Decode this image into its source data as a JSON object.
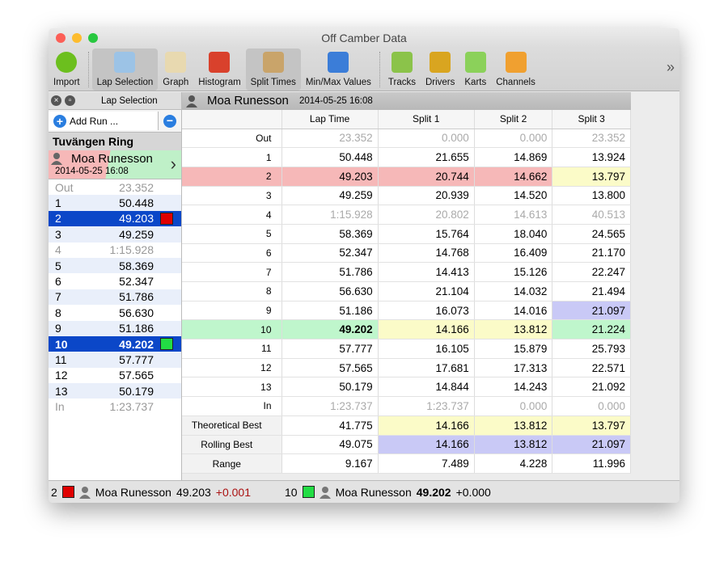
{
  "window": {
    "title": "Off Camber Data"
  },
  "toolbar": {
    "items": [
      {
        "label": "Import",
        "icon": "import-icon",
        "color": "#6cbf1e"
      },
      {
        "label": "Lap Selection",
        "icon": "lap-selection-icon",
        "color": "#9cc3e6",
        "selected": true
      },
      {
        "label": "Graph",
        "icon": "graph-icon",
        "color": "#e8d9b0"
      },
      {
        "label": "Histogram",
        "icon": "histogram-icon",
        "color": "#d9412c"
      },
      {
        "label": "Split Times",
        "icon": "split-times-icon",
        "color": "#c9a46a",
        "selected": true
      },
      {
        "label": "Min/Max Values",
        "icon": "min-max-icon",
        "color": "#3b7dd8"
      },
      {
        "label": "Tracks",
        "icon": "tracks-icon",
        "color": "#8bc34a"
      },
      {
        "label": "Drivers",
        "icon": "drivers-icon",
        "color": "#d9a520"
      },
      {
        "label": "Karts",
        "icon": "karts-icon",
        "color": "#8bd15a"
      },
      {
        "label": "Channels",
        "icon": "channels-icon",
        "color": "#f0a030"
      }
    ],
    "more": "»"
  },
  "left": {
    "title": "Lap Selection",
    "add_run": "Add Run ...",
    "track": "Tuvängen Ring",
    "run": {
      "driver": "Moa Runesson",
      "date": "2014-05-25 16:08"
    },
    "laps": [
      {
        "n": "Out",
        "t": "23.352",
        "dim": true
      },
      {
        "n": "1",
        "t": "50.448"
      },
      {
        "n": "2",
        "t": "49.203",
        "sel": true,
        "swatch": "#e00000"
      },
      {
        "n": "3",
        "t": "49.259"
      },
      {
        "n": "4",
        "t": "1:15.928",
        "dim": true
      },
      {
        "n": "5",
        "t": "58.369"
      },
      {
        "n": "6",
        "t": "52.347"
      },
      {
        "n": "7",
        "t": "51.786"
      },
      {
        "n": "8",
        "t": "56.630"
      },
      {
        "n": "9",
        "t": "51.186"
      },
      {
        "n": "10",
        "t": "49.202",
        "sel": true,
        "bold": true,
        "swatch": "#22dd44"
      },
      {
        "n": "11",
        "t": "57.777"
      },
      {
        "n": "12",
        "t": "57.565"
      },
      {
        "n": "13",
        "t": "50.179"
      },
      {
        "n": "In",
        "t": "1:23.737",
        "dim": true
      }
    ]
  },
  "main": {
    "driver": "Moa Runesson",
    "date": "2014-05-25 16:08",
    "columns": [
      "",
      "Lap Time",
      "Split 1",
      "Split 2",
      "Split 3"
    ],
    "rows": [
      {
        "cells": [
          "Out",
          "23.352",
          "0.000",
          "0.000",
          "23.352"
        ],
        "hl": [
          "",
          "dim",
          "dim",
          "dim",
          "dim"
        ]
      },
      {
        "cells": [
          "1",
          "50.448",
          "21.655",
          "14.869",
          "13.924"
        ],
        "hl": [
          "",
          "",
          "",
          "",
          ""
        ]
      },
      {
        "cells": [
          "2",
          "49.203",
          "20.744",
          "14.662",
          "13.797"
        ],
        "hl": [
          "red",
          "red",
          "red",
          "red",
          "yellow"
        ]
      },
      {
        "cells": [
          "3",
          "49.259",
          "20.939",
          "14.520",
          "13.800"
        ],
        "hl": [
          "",
          "",
          "",
          "",
          ""
        ]
      },
      {
        "cells": [
          "4",
          "1:15.928",
          "20.802",
          "14.613",
          "40.513"
        ],
        "hl": [
          "",
          "dim",
          "dim",
          "dim",
          "dim"
        ]
      },
      {
        "cells": [
          "5",
          "58.369",
          "15.764",
          "18.040",
          "24.565"
        ],
        "hl": [
          "",
          "",
          "",
          "",
          ""
        ]
      },
      {
        "cells": [
          "6",
          "52.347",
          "14.768",
          "16.409",
          "21.170"
        ],
        "hl": [
          "",
          "",
          "",
          "",
          ""
        ]
      },
      {
        "cells": [
          "7",
          "51.786",
          "14.413",
          "15.126",
          "22.247"
        ],
        "hl": [
          "",
          "",
          "",
          "",
          ""
        ]
      },
      {
        "cells": [
          "8",
          "56.630",
          "21.104",
          "14.032",
          "21.494"
        ],
        "hl": [
          "",
          "",
          "",
          "",
          ""
        ]
      },
      {
        "cells": [
          "9",
          "51.186",
          "16.073",
          "14.016",
          "21.097"
        ],
        "hl": [
          "",
          "",
          "",
          "",
          "blue"
        ]
      },
      {
        "cells": [
          "10",
          "49.202",
          "14.166",
          "13.812",
          "21.224"
        ],
        "hl": [
          "green",
          "green b",
          "yellow",
          "yellow",
          "green"
        ]
      },
      {
        "cells": [
          "11",
          "57.777",
          "16.105",
          "15.879",
          "25.793"
        ],
        "hl": [
          "",
          "",
          "",
          "",
          ""
        ]
      },
      {
        "cells": [
          "12",
          "57.565",
          "17.681",
          "17.313",
          "22.571"
        ],
        "hl": [
          "",
          "",
          "",
          "",
          ""
        ]
      },
      {
        "cells": [
          "13",
          "50.179",
          "14.844",
          "14.243",
          "21.092"
        ],
        "hl": [
          "",
          "",
          "",
          "",
          ""
        ]
      },
      {
        "cells": [
          "In",
          "1:23.737",
          "1:23.737",
          "0.000",
          "0.000"
        ],
        "hl": [
          "",
          "dim",
          "dim",
          "dim",
          "dim"
        ]
      },
      {
        "cells": [
          "Theoretical Best",
          "41.775",
          "14.166",
          "13.812",
          "13.797"
        ],
        "hl": [
          "c gray",
          "",
          "yellow",
          "yellow",
          "yellow"
        ]
      },
      {
        "cells": [
          "Rolling Best",
          "49.075",
          "14.166",
          "13.812",
          "21.097"
        ],
        "hl": [
          "c gray",
          "",
          "blue",
          "blue",
          "blue"
        ]
      },
      {
        "cells": [
          "Range",
          "9.167",
          "7.489",
          "4.228",
          "11.996"
        ],
        "hl": [
          "c gray",
          "",
          "",
          "",
          ""
        ]
      }
    ]
  },
  "status": {
    "a": {
      "lap": "2",
      "swatch": "#e00000",
      "driver": "Moa Runesson",
      "time": "49.203",
      "delta": "+0.001"
    },
    "b": {
      "lap": "10",
      "swatch": "#22dd44",
      "driver": "Moa Runesson",
      "time": "49.202",
      "delta": "+0.000"
    }
  }
}
